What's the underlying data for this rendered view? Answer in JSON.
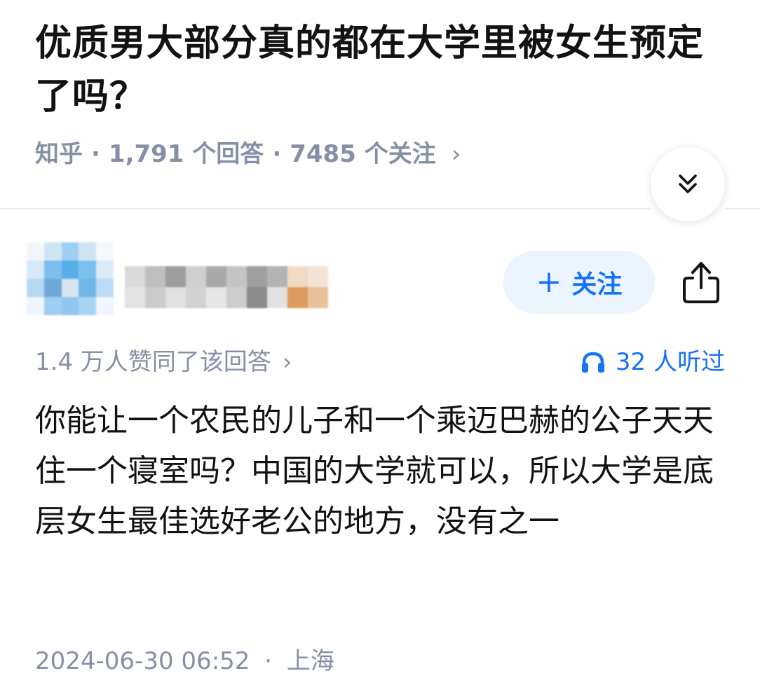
{
  "question": {
    "title": "优质男大部分真的都在大学里被女生预定了吗？",
    "source": "知乎",
    "answers_count": "1,791 个回答",
    "followers_count": "7485 个关注",
    "separator": "·",
    "chevron": "›"
  },
  "collapse_icon": "double-chevron-down-icon",
  "author": {
    "follow_label": "关注",
    "follow_plus": "+",
    "share_icon": "share-icon"
  },
  "answer": {
    "votes": "1.4 万人赞同了该回答",
    "votes_chevron": "›",
    "listens": "32 人听过",
    "listen_icon": "headphones-icon",
    "content": "你能让一个农民的儿子和一个乘迈巴赫的公子天天住一个寝室吗？中国的大学就可以，所以大学是底层女生最佳选好老公的地方，没有之一",
    "date": "2024-06-30 06:52",
    "separator": "·",
    "location": "上海"
  },
  "colors": {
    "accent": "#1772f6",
    "follow_bg": "#ebf4ff",
    "meta_gray": "#8590a6",
    "text": "#121212"
  }
}
